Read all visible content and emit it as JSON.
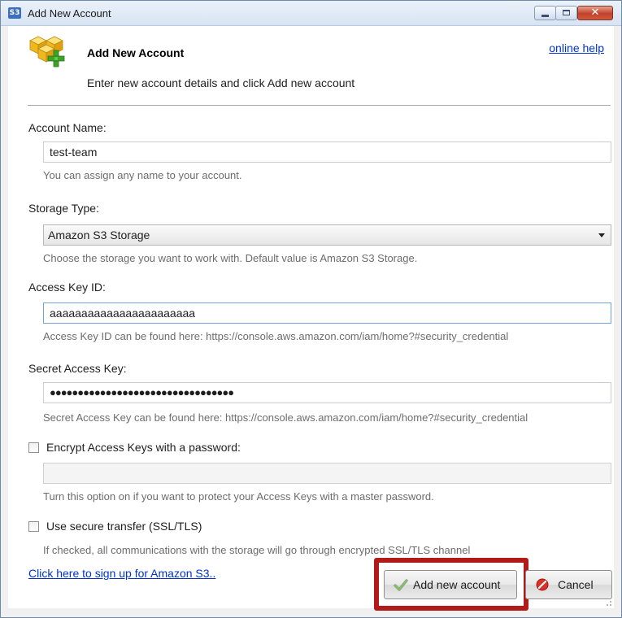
{
  "window": {
    "title": "Add New Account",
    "app_icon_text": "S3",
    "close_symbol": "✕"
  },
  "header": {
    "title": "Add New Account",
    "subtitle": "Enter new account details and click Add new account",
    "help_link": "online help",
    "icon": "boxes-add-icon"
  },
  "form": {
    "account_name": {
      "label": "Account Name:",
      "value": "test-team",
      "hint": "You can assign any name to your account."
    },
    "storage_type": {
      "label": "Storage Type:",
      "value": "Amazon S3 Storage",
      "hint": "Choose the storage you want to work with. Default value is Amazon S3 Storage."
    },
    "access_key_id": {
      "label": "Access Key ID:",
      "value": "aaaaaaaaaaaaaaaaaaaaaaa",
      "hint": "Access Key ID can be found here: https://console.aws.amazon.com/iam/home?#security_credential"
    },
    "secret_access_key": {
      "label": "Secret Access Key:",
      "value": "●●●●●●●●●●●●●●●●●●●●●●●●●●●●●●●●●",
      "hint": "Secret Access Key can be found here: https://console.aws.amazon.com/iam/home?#security_credential"
    },
    "encrypt": {
      "label": "Encrypt Access Keys with a password:",
      "checked": false,
      "value": "",
      "hint": "Turn this option on if you want to protect your Access Keys with a master password."
    },
    "secure_transfer": {
      "label": "Use secure transfer (SSL/TLS)",
      "checked": false,
      "hint": "If checked, all communications with the storage will go through encrypted SSL/TLS channel"
    }
  },
  "footer": {
    "signup_link": "Click here to sign up for Amazon S3..",
    "add_button": "Add new account",
    "cancel_button": "Cancel",
    "highlight_color": "#b21a1a"
  },
  "colors": {
    "link": "#0033cc",
    "hint_text": "#6d6d6d",
    "window_border": "#6f8aa8"
  }
}
